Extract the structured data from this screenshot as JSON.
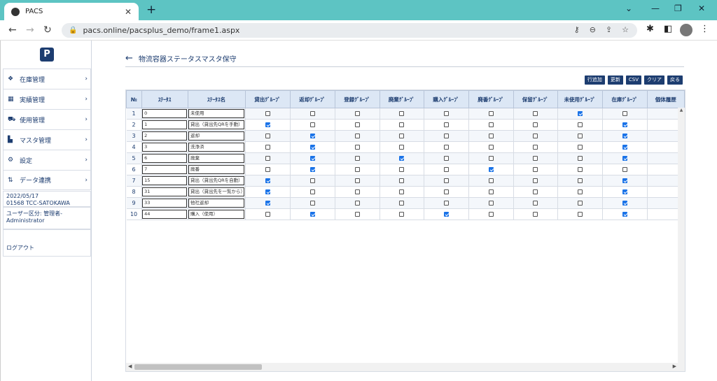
{
  "browser": {
    "tab_title": "PACS",
    "url": "pacs.online/pacsplus_demo/frame1.aspx"
  },
  "sidebar": {
    "logo": "P",
    "items": [
      {
        "label": "在庫管理",
        "icon": "boxes-icon"
      },
      {
        "label": "実績管理",
        "icon": "table-icon"
      },
      {
        "label": "使用管理",
        "icon": "cart-icon"
      },
      {
        "label": "マスタ管理",
        "icon": "document-icon"
      },
      {
        "label": "設定",
        "icon": "gear-icon"
      },
      {
        "label": "データ連携",
        "icon": "sync-icon"
      }
    ],
    "date": "2022/05/17",
    "user": "01568 TCC-SATOKAWA",
    "role": "ユーザー区分: 管理者-Administrator",
    "logout": "ログアウト"
  },
  "main": {
    "title": "物流容器ステータスマスタ保守",
    "buttons": [
      "行追加",
      "更新",
      "CSV",
      "クリア",
      "戻る"
    ],
    "columns": [
      "№",
      "ｽﾃｰﾀｽ",
      "ｽﾃｰﾀｽ名",
      "貸出ｸﾞﾙｰﾌﾟ",
      "返却ｸﾞﾙｰﾌﾟ",
      "登録ｸﾞﾙｰﾌﾟ",
      "廃棄ｸﾞﾙｰﾌﾟ",
      "購入ｸﾞﾙｰﾌﾟ",
      "廃番ｸﾞﾙｰﾌﾟ",
      "保留ｸﾞﾙｰﾌﾟ",
      "未使用ｸﾞﾙｰﾌﾟ",
      "在庫ｸﾞﾙｰﾌﾟ",
      "個体履歴"
    ],
    "rows": [
      {
        "no": "1",
        "status": "0",
        "name": "未使用",
        "checks": [
          0,
          0,
          0,
          0,
          0,
          0,
          0,
          1,
          0
        ]
      },
      {
        "no": "2",
        "status": "1",
        "name": "貸出（貸出先QRを手動）",
        "checks": [
          1,
          0,
          0,
          0,
          0,
          0,
          0,
          0,
          1
        ]
      },
      {
        "no": "3",
        "status": "2",
        "name": "返却",
        "checks": [
          0,
          1,
          0,
          0,
          0,
          0,
          0,
          0,
          1
        ]
      },
      {
        "no": "4",
        "status": "3",
        "name": "洗浄済",
        "checks": [
          0,
          1,
          0,
          0,
          0,
          0,
          0,
          0,
          1
        ]
      },
      {
        "no": "5",
        "status": "6",
        "name": "廃棄",
        "checks": [
          0,
          1,
          0,
          1,
          0,
          0,
          0,
          0,
          1
        ]
      },
      {
        "no": "6",
        "status": "7",
        "name": "廃番",
        "checks": [
          0,
          1,
          0,
          0,
          0,
          1,
          0,
          0,
          0
        ]
      },
      {
        "no": "7",
        "status": "15",
        "name": "貸出（貸出先QRを自動）",
        "checks": [
          1,
          0,
          0,
          0,
          0,
          0,
          0,
          0,
          1
        ]
      },
      {
        "no": "8",
        "status": "31",
        "name": "貸出（貸出先を一覧から）",
        "checks": [
          1,
          0,
          0,
          0,
          0,
          0,
          0,
          0,
          1
        ]
      },
      {
        "no": "9",
        "status": "33",
        "name": "他社返却",
        "checks": [
          1,
          0,
          0,
          0,
          0,
          0,
          0,
          0,
          1
        ]
      },
      {
        "no": "10",
        "status": "44",
        "name": "購入（使用）",
        "checks": [
          0,
          1,
          0,
          0,
          1,
          0,
          0,
          0,
          1
        ]
      }
    ]
  }
}
